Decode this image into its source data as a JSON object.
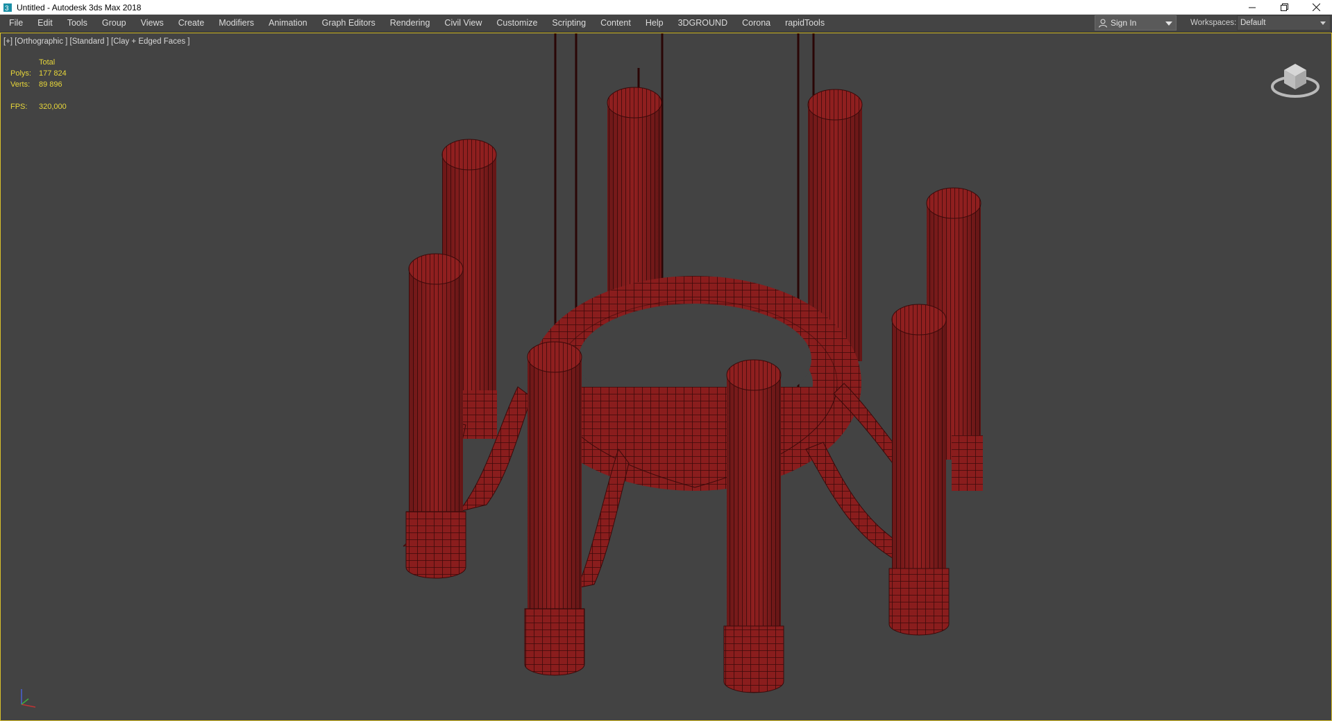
{
  "window": {
    "title": "Untitled - Autodesk 3ds Max 2018",
    "controls": [
      "minimize-icon",
      "restore-icon",
      "close-icon"
    ]
  },
  "menu": {
    "items": [
      "File",
      "Edit",
      "Tools",
      "Group",
      "Views",
      "Create",
      "Modifiers",
      "Animation",
      "Graph Editors",
      "Rendering",
      "Civil View",
      "Customize",
      "Scripting",
      "Content",
      "Help",
      "3DGROUND",
      "Corona",
      "rapidTools"
    ]
  },
  "account": {
    "sign_in_label": "Sign In"
  },
  "workspaces": {
    "label": "Workspaces:",
    "value": "Default"
  },
  "viewport": {
    "label": "[+] [Orthographic ] [Standard ] [Clay + Edged Faces ]",
    "stats": {
      "header": "Total",
      "polys_label": "Polys:",
      "polys_value": "177 824",
      "verts_label": "Verts:",
      "verts_value": "89 896",
      "fps_label": "FPS:",
      "fps_value": "320,000"
    },
    "object_color": "#8f1f1f",
    "wire_color": "#3a0a0a",
    "background_color": "#434343"
  }
}
